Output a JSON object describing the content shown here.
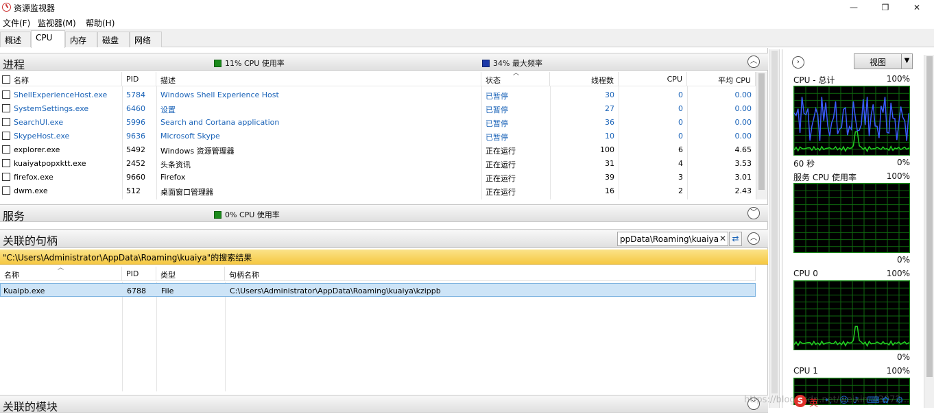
{
  "window": {
    "title": "资源监视器",
    "minimize": "—",
    "maximize": "❐",
    "close": "✕"
  },
  "menu": [
    "文件(F)",
    "监视器(M)",
    "帮助(H)"
  ],
  "tabs": [
    "概述",
    "CPU",
    "内存",
    "磁盘",
    "网络"
  ],
  "process": {
    "title": "进程",
    "cpu_usage": "11% CPU 使用率",
    "max_freq": "34% 最大频率",
    "columns": [
      "名称",
      "PID",
      "描述",
      "状态",
      "线程数",
      "CPU",
      "平均 CPU"
    ],
    "rows": [
      {
        "name": "ShellExperienceHost.exe",
        "pid": "5784",
        "desc": "Windows Shell Experience Host",
        "status": "已暂停",
        "threads": "30",
        "cpu": "0",
        "avg": "0.00",
        "suspended": true
      },
      {
        "name": "SystemSettings.exe",
        "pid": "6460",
        "desc": "设置",
        "status": "已暂停",
        "threads": "27",
        "cpu": "0",
        "avg": "0.00",
        "suspended": true
      },
      {
        "name": "SearchUI.exe",
        "pid": "5996",
        "desc": "Search and Cortana application",
        "status": "已暂停",
        "threads": "36",
        "cpu": "0",
        "avg": "0.00",
        "suspended": true
      },
      {
        "name": "SkypeHost.exe",
        "pid": "9636",
        "desc": "Microsoft Skype",
        "status": "已暂停",
        "threads": "10",
        "cpu": "0",
        "avg": "0.00",
        "suspended": true
      },
      {
        "name": "explorer.exe",
        "pid": "5492",
        "desc": "Windows 资源管理器",
        "status": "正在运行",
        "threads": "100",
        "cpu": "6",
        "avg": "4.65",
        "suspended": false
      },
      {
        "name": "kuaiyatpopxktt.exe",
        "pid": "2452",
        "desc": "头条资讯",
        "status": "正在运行",
        "threads": "31",
        "cpu": "4",
        "avg": "3.53",
        "suspended": false
      },
      {
        "name": "firefox.exe",
        "pid": "9660",
        "desc": "Firefox",
        "status": "正在运行",
        "threads": "39",
        "cpu": "3",
        "avg": "3.01",
        "suspended": false
      },
      {
        "name": "dwm.exe",
        "pid": "512",
        "desc": "桌面窗口管理器",
        "status": "正在运行",
        "threads": "16",
        "cpu": "2",
        "avg": "2.43",
        "suspended": false
      }
    ]
  },
  "services": {
    "title": "服务",
    "cpu_usage": "0% CPU 使用率"
  },
  "handles": {
    "title": "关联的句柄",
    "search_value": "ppData\\Roaming\\kuaiya",
    "search_result": "\"C:\\Users\\Administrator\\AppData\\Roaming\\kuaiya\"的搜索结果",
    "columns": [
      "名称",
      "PID",
      "类型",
      "句柄名称"
    ],
    "rows": [
      {
        "name": "Kuaipb.exe",
        "pid": "6788",
        "type": "File",
        "handle": "C:\\Users\\Administrator\\AppData\\Roaming\\kuaiya\\kzippb"
      }
    ]
  },
  "modules": {
    "title": "关联的模块"
  },
  "right_panel": {
    "view_label": "视图",
    "graphs": [
      {
        "title": "CPU - 总计",
        "max": "100%",
        "left_bottom": "60 秒",
        "min": "0%"
      },
      {
        "title": "服务 CPU 使用率",
        "max": "100%",
        "left_bottom": "",
        "min": "0%"
      },
      {
        "title": "CPU 0",
        "max": "100%",
        "left_bottom": "",
        "min": "0%"
      },
      {
        "title": "CPU 1",
        "max": "100%",
        "left_bottom": "",
        "min": ""
      }
    ]
  },
  "colors": {
    "link_blue": "#1a63b8",
    "graph_green": "#22d022",
    "graph_blue": "#3a5cff",
    "search_banner": "#f7d35a"
  },
  "ime_text": "英",
  "watermark": "https://blog.csdn.net/weixin_43072..."
}
